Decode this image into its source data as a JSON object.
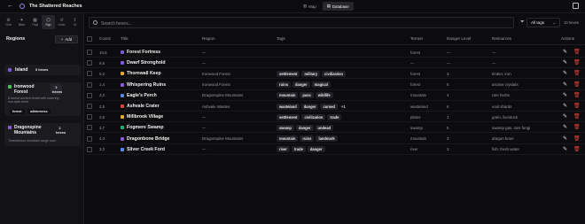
{
  "app": {
    "title": "The Shattered Reaches"
  },
  "top_nav": {
    "back_icon": "arrow-left-icon",
    "views": [
      {
        "label": "Map",
        "icon": "map-icon",
        "active": false
      },
      {
        "label": "Database",
        "icon": "database-icon",
        "active": true
      }
    ]
  },
  "sidebar": {
    "tools": [
      {
        "label": "Grid",
        "icon": "grid-icon"
      },
      {
        "label": "Bktm",
        "icon": "bookmark-icon"
      },
      {
        "label": "Tmpl",
        "icon": "template-icon"
      },
      {
        "label": "Rgn",
        "icon": "region-icon",
        "active": true
      },
      {
        "label": "Undo",
        "icon": "undo-icon"
      },
      {
        "label": "Ul",
        "icon": "upload-icon"
      }
    ],
    "heading": "Regions",
    "add_label": "Add",
    "regions": [
      {
        "name": "Island",
        "count": "0 hexes",
        "color": "#7c5cd6"
      },
      {
        "name": "Ironwood Forest",
        "count": "2 hexes",
        "color": "#46c25b",
        "description": "A dense ancient forest with towering iron-dark trees",
        "tags": [
          "forest",
          "wilderness"
        ]
      },
      {
        "name": "Dragonspine Mountains",
        "count": "2 hexes",
        "color": "#8a5cd6",
        "description": "Treacherous mountain range said"
      }
    ]
  },
  "toolbar": {
    "search_placeholder": "Search hexes...",
    "tags_filter": "All tags",
    "hex_count": "10 hexes"
  },
  "table": {
    "columns": {
      "coord": "Coord",
      "title": "Title",
      "region": "Region",
      "tags": "Tags",
      "terrain": "Terrain",
      "danger": "Danger Level",
      "resources": "Resources",
      "actions": "Actions"
    },
    "rows": [
      {
        "coord": "10,6",
        "title": "Forest Fortress",
        "color": "#7c5cd6",
        "region": "—",
        "tags": [],
        "more": "",
        "terrain": "forest",
        "danger": "—",
        "resources": "—"
      },
      {
        "coord": "9,6",
        "title": "Dwarf Stronghold",
        "color": "#7c5cd6",
        "region": "—",
        "tags": [],
        "more": "",
        "terrain": "—",
        "danger": "—",
        "resources": "—"
      },
      {
        "coord": "0,3",
        "title": "Thornwall Keep",
        "color": "#e5a733",
        "region": "Ironwood Forest",
        "tags": [
          "settlement",
          "military",
          "civilization"
        ],
        "more": "",
        "terrain": "forest",
        "danger": "3",
        "resources": "timber, iron"
      },
      {
        "coord": "1,4",
        "title": "Whispering Ruins",
        "color": "#8a5cd6",
        "region": "Ironwood Forest",
        "tags": [
          "ruins",
          "danger",
          "magical"
        ],
        "more": "",
        "terrain": "forest",
        "danger": "5",
        "resources": "arcane crystals"
      },
      {
        "coord": "4,2",
        "title": "Eagle's Perch",
        "color": "#5b8be0",
        "region": "Dragonspine Mountains",
        "tags": [
          "mountain",
          "pass",
          "wildlife"
        ],
        "more": "",
        "terrain": "mountain",
        "danger": "4",
        "resources": "rare herbs"
      },
      {
        "coord": "2,5",
        "title": "Ashvale Crater",
        "color": "#e0443e",
        "region": "Ashvale Wastes",
        "tags": [
          "wasteland",
          "danger",
          "cursed"
        ],
        "more": "+1",
        "terrain": "wasteland",
        "danger": "6",
        "resources": "void shards"
      },
      {
        "coord": "2,6",
        "title": "Millbrook Village",
        "color": "#e5a733",
        "region": "—",
        "tags": [
          "settlement",
          "civilization",
          "trade"
        ],
        "more": "",
        "terrain": "plains",
        "danger": "1",
        "resources": "grain, livestock"
      },
      {
        "coord": "3,7",
        "title": "Fogmere Swamp",
        "color": "#2aa876",
        "region": "—",
        "tags": [
          "swamp",
          "danger",
          "undead"
        ],
        "more": "",
        "terrain": "swamp",
        "danger": "5",
        "resources": "swamp gas, rare fungi"
      },
      {
        "coord": "4,3",
        "title": "Dragonbone Bridge",
        "color": "#8a5cd6",
        "region": "Dragonspine Mountains",
        "tags": [
          "mountain",
          "ruins",
          "landmark"
        ],
        "more": "",
        "terrain": "mountain",
        "danger": "3",
        "resources": "dragon bone"
      },
      {
        "coord": "3,3",
        "title": "Silver Creek Ford",
        "color": "#4f8de8",
        "region": "—",
        "tags": [
          "river",
          "trade",
          "danger"
        ],
        "more": "",
        "terrain": "river",
        "danger": "3",
        "resources": "fish, fresh water"
      }
    ]
  }
}
